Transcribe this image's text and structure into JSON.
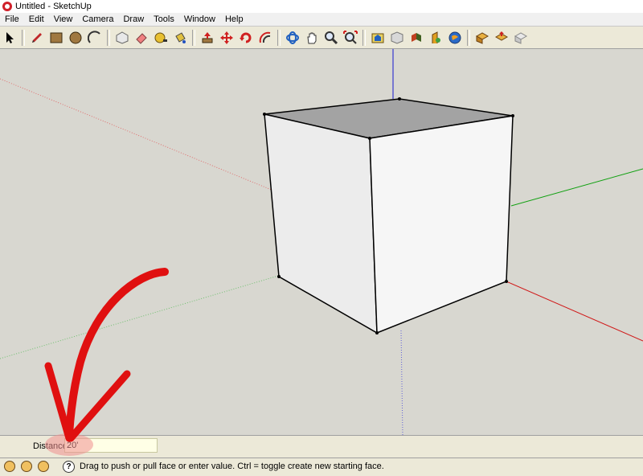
{
  "window": {
    "title": "Untitled - SketchUp"
  },
  "menu": {
    "items": [
      "File",
      "Edit",
      "View",
      "Camera",
      "Draw",
      "Tools",
      "Window",
      "Help"
    ]
  },
  "toolbar": {
    "tools": [
      "select-icon",
      "pencil-icon",
      "rectangle-icon",
      "circle-icon",
      "arc-icon",
      "make-component-icon",
      "eraser-icon",
      "tape-measure-icon",
      "paint-bucket-icon",
      "push-pull-icon",
      "move-icon",
      "rotate-icon",
      "offset-icon",
      "orbit-icon",
      "pan-icon",
      "zoom-icon",
      "zoom-extents-icon",
      "get-models-icon",
      "share-model-icon",
      "get-photo-texture-icon",
      "warehouse-icon",
      "google-earth-icon",
      "component-icon",
      "share-component-icon",
      "dynamic-components-icon"
    ]
  },
  "vcb": {
    "label": "Distance",
    "value": "20'"
  },
  "status": {
    "message": "Drag to push or pull face or enter value.  Ctrl = toggle create new starting face."
  },
  "colors": {
    "viewport_bg": "#d8d7d0",
    "red_axis": "#d01818",
    "green_axis": "#10a010",
    "blue_axis": "#1818d0",
    "annotation_arrow": "#e01010"
  }
}
